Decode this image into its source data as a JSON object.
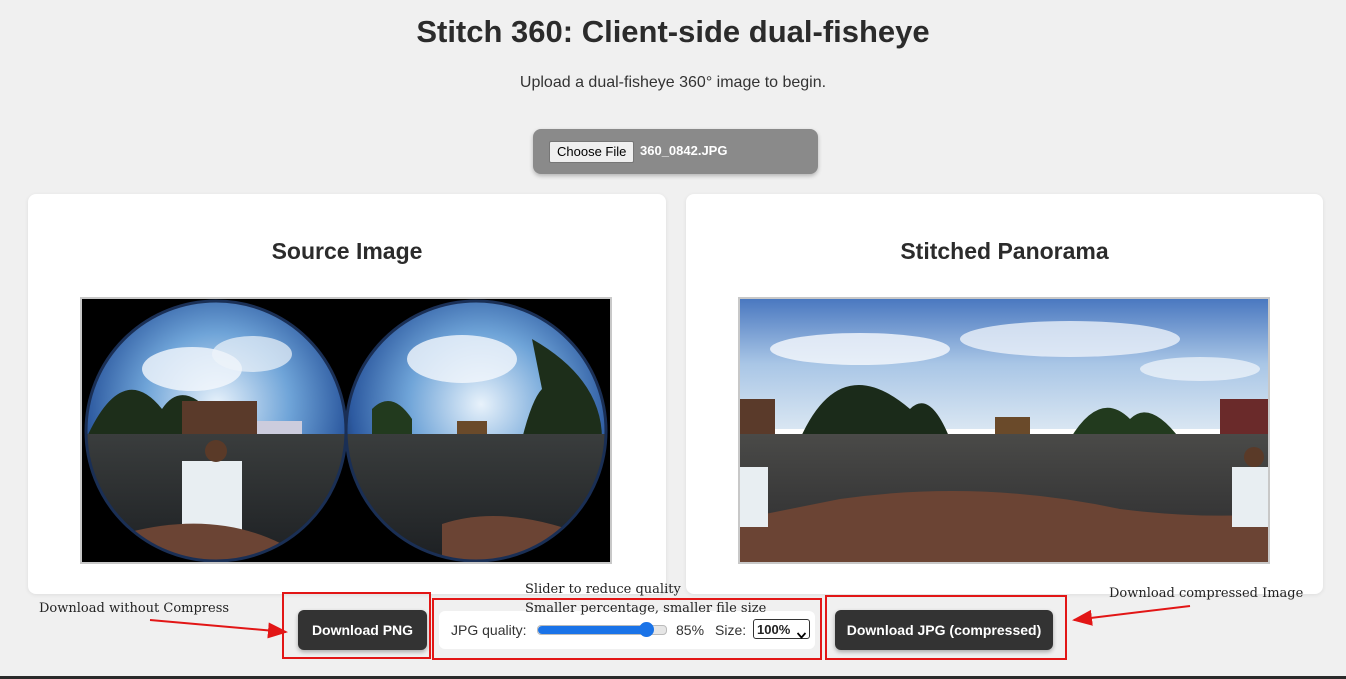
{
  "header": {
    "title": "Stitch 360: Client-side dual-fisheye",
    "subtitle": "Upload a dual-fisheye 360° image to begin."
  },
  "file_input": {
    "button_label": "Choose File",
    "file_name": "360_0842.JPG"
  },
  "source_panel": {
    "heading": "Source Image"
  },
  "result_panel": {
    "heading": "Stitched Panorama"
  },
  "controls": {
    "download_png_label": "Download PNG",
    "download_jpg_label": "Download JPG (compressed)",
    "quality_label": "JPG quality:",
    "quality_value": 85,
    "quality_text": "85%",
    "size_label": "Size:",
    "size_selected": "100%"
  },
  "annotations": {
    "left": "Download without Compress",
    "middle_line1": "Slider to reduce quality",
    "middle_line2": "Smaller percentage, smaller file size",
    "right": "Download compressed Image"
  },
  "colors": {
    "accent": "#1a73e8",
    "annotation_red": "#e21616",
    "button_dark": "#333333",
    "background": "#f0f0f0"
  }
}
